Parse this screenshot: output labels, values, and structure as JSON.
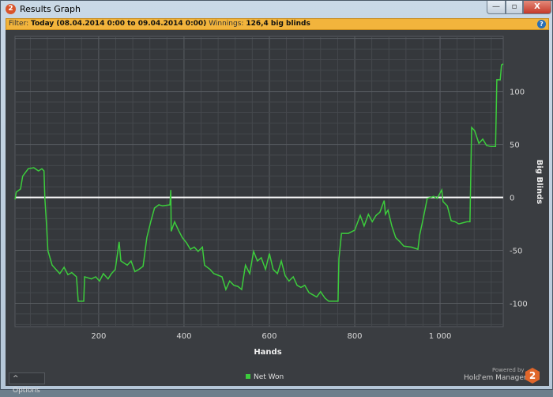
{
  "window": {
    "title": "Results Graph",
    "app_icon": "2",
    "minimize": "—",
    "maximize": "▫",
    "close": "X"
  },
  "filter": {
    "label": "Filter:",
    "value": "Today (08.04.2014 0:00 to 09.04.2014 0:00)",
    "winnings_label": "Winnings:",
    "winnings_value": "126,4 big blinds",
    "help": "?"
  },
  "footer": {
    "options_label": "Options",
    "options_icon": "^",
    "powered_by": "Powered by",
    "brand": "Hold'em Manager",
    "brand_logo": "2"
  },
  "colors": {
    "line": "#3ccc3c",
    "zero_line": "#ffffff",
    "filter_bar": "#f2b43c",
    "background": "#3a3d41"
  },
  "chart_data": {
    "type": "line",
    "title": "",
    "xlabel": "Hands",
    "ylabel": "Big Blinds",
    "xlim": [
      4,
      1148
    ],
    "ylim": [
      -122,
      152
    ],
    "xticks": [
      200,
      400,
      600,
      800,
      1000
    ],
    "xtick_labels": [
      "200",
      "400",
      "600",
      "800",
      "1 000"
    ],
    "yticks": [
      100,
      50,
      0,
      -50,
      -100
    ],
    "ytick_labels": [
      "100",
      "50",
      "0",
      "-50",
      "-100"
    ],
    "grid": true,
    "legend": {
      "position": "bottom-center",
      "entries": [
        "Net Won"
      ]
    },
    "series": [
      {
        "name": "Net Won",
        "points": [
          [
            4,
            -2
          ],
          [
            7,
            5
          ],
          [
            17,
            8
          ],
          [
            22,
            20
          ],
          [
            35,
            27
          ],
          [
            48,
            28
          ],
          [
            59,
            25
          ],
          [
            67,
            27
          ],
          [
            72,
            25
          ],
          [
            74,
            -1
          ],
          [
            78,
            -27
          ],
          [
            81,
            -50
          ],
          [
            91,
            -64
          ],
          [
            100,
            -68
          ],
          [
            109,
            -72
          ],
          [
            119,
            -66
          ],
          [
            128,
            -73
          ],
          [
            137,
            -71
          ],
          [
            148,
            -75
          ],
          [
            152,
            -98
          ],
          [
            165,
            -98
          ],
          [
            167,
            -75
          ],
          [
            183,
            -77
          ],
          [
            193,
            -75
          ],
          [
            202,
            -79
          ],
          [
            211,
            -72
          ],
          [
            222,
            -77
          ],
          [
            230,
            -72
          ],
          [
            239,
            -68
          ],
          [
            248,
            -42
          ],
          [
            252,
            -60
          ],
          [
            267,
            -64
          ],
          [
            276,
            -60
          ],
          [
            285,
            -70
          ],
          [
            294,
            -68
          ],
          [
            304,
            -65
          ],
          [
            313,
            -38
          ],
          [
            322,
            -23
          ],
          [
            331,
            -10
          ],
          [
            341,
            -7
          ],
          [
            350,
            -8
          ],
          [
            367,
            -7
          ],
          [
            369,
            7
          ],
          [
            370,
            -32
          ],
          [
            378,
            -23
          ],
          [
            387,
            -31
          ],
          [
            396,
            -38
          ],
          [
            406,
            -43
          ],
          [
            415,
            -49
          ],
          [
            424,
            -47
          ],
          [
            433,
            -51
          ],
          [
            443,
            -47
          ],
          [
            448,
            -64
          ],
          [
            461,
            -68
          ],
          [
            470,
            -72
          ],
          [
            489,
            -75
          ],
          [
            498,
            -87
          ],
          [
            507,
            -79
          ],
          [
            517,
            -83
          ],
          [
            526,
            -84
          ],
          [
            535,
            -87
          ],
          [
            544,
            -64
          ],
          [
            554,
            -72
          ],
          [
            563,
            -51
          ],
          [
            572,
            -60
          ],
          [
            581,
            -57
          ],
          [
            591,
            -68
          ],
          [
            600,
            -53
          ],
          [
            609,
            -68
          ],
          [
            619,
            -72
          ],
          [
            628,
            -60
          ],
          [
            637,
            -74
          ],
          [
            646,
            -79
          ],
          [
            656,
            -75
          ],
          [
            665,
            -83
          ],
          [
            674,
            -85
          ],
          [
            683,
            -83
          ],
          [
            693,
            -90
          ],
          [
            702,
            -92
          ],
          [
            711,
            -94
          ],
          [
            720,
            -89
          ],
          [
            730,
            -95
          ],
          [
            739,
            -98
          ],
          [
            761,
            -98
          ],
          [
            763,
            -58
          ],
          [
            769,
            -34
          ],
          [
            785,
            -34
          ],
          [
            800,
            -31
          ],
          [
            813,
            -17
          ],
          [
            822,
            -27
          ],
          [
            832,
            -16
          ],
          [
            841,
            -23
          ],
          [
            850,
            -17
          ],
          [
            859,
            -14
          ],
          [
            869,
            -3
          ],
          [
            872,
            -16
          ],
          [
            878,
            -12
          ],
          [
            887,
            -27
          ],
          [
            896,
            -38
          ],
          [
            906,
            -42
          ],
          [
            915,
            -46
          ],
          [
            933,
            -47
          ],
          [
            948,
            -49
          ],
          [
            952,
            -36
          ],
          [
            961,
            -19
          ],
          [
            970,
            -1
          ],
          [
            985,
            1
          ],
          [
            993,
            -1
          ],
          [
            1004,
            7
          ],
          [
            1007,
            -4
          ],
          [
            1017,
            -8
          ],
          [
            1026,
            -22
          ],
          [
            1035,
            -23
          ],
          [
            1044,
            -25
          ],
          [
            1063,
            -23
          ],
          [
            1070,
            -23
          ],
          [
            1074,
            66
          ],
          [
            1081,
            63
          ],
          [
            1091,
            51
          ],
          [
            1100,
            55
          ],
          [
            1109,
            49
          ],
          [
            1119,
            48
          ],
          [
            1130,
            48
          ],
          [
            1133,
            111
          ],
          [
            1141,
            111
          ],
          [
            1144,
            125
          ],
          [
            1148,
            126
          ]
        ]
      }
    ]
  }
}
